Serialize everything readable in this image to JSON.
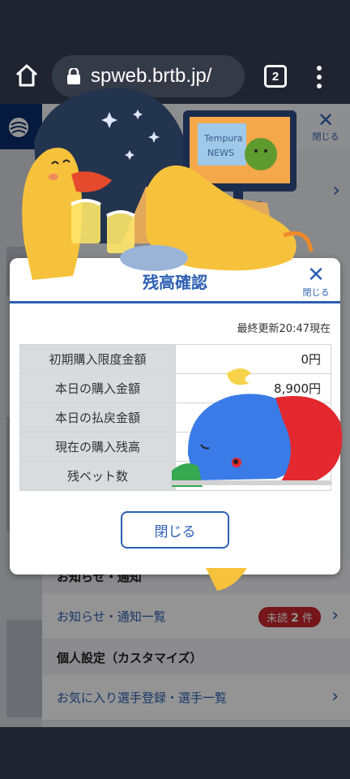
{
  "browser": {
    "url": "spweb.brtb.jp/",
    "tab_count": "2"
  },
  "page": {
    "header_close": "閉じる",
    "sections": [
      {
        "title": "お知らせ・通知",
        "links": [
          {
            "label": "お知らせ・通知一覧",
            "badge_prefix": "未読",
            "badge_count": "2",
            "badge_suffix": "件"
          }
        ]
      },
      {
        "title": "個人設定（カスタマイズ）",
        "links": [
          {
            "label": "お気に入り選手登録・選手一覧"
          }
        ]
      }
    ]
  },
  "modal": {
    "title": "残高確認",
    "close_label": "閉じる",
    "updated": "最終更新20:47現在",
    "rows": [
      {
        "label": "初期購入限度金額",
        "value": "0円"
      },
      {
        "label": "本日の購入金額",
        "value": "8,900円"
      },
      {
        "label": "本日の払戻金額",
        "value": ""
      },
      {
        "label": "現在の購入残高",
        "value": ""
      },
      {
        "label": "残ベット数",
        "value": ""
      }
    ],
    "button": "閉じる"
  },
  "sticker": {
    "tv_text_1": "Tempura",
    "tv_text_2": "NEWS"
  },
  "colors": {
    "accent": "#2d5fb3",
    "badge": "#c8262e",
    "chrome": "#1f2430"
  }
}
